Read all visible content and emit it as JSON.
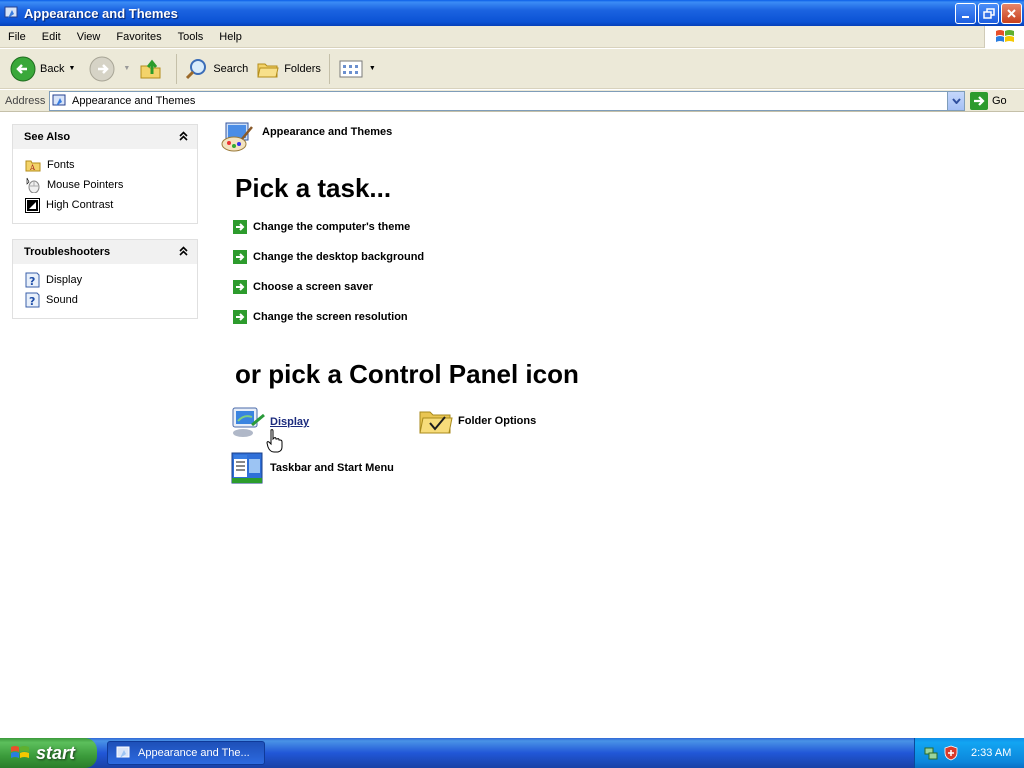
{
  "window": {
    "title": "Appearance and Themes"
  },
  "menu": {
    "items": [
      "File",
      "Edit",
      "View",
      "Favorites",
      "Tools",
      "Help"
    ]
  },
  "toolbar": {
    "back": "Back",
    "search": "Search",
    "folders": "Folders"
  },
  "address": {
    "label": "Address",
    "value": "Appearance and Themes",
    "go": "Go"
  },
  "see_also": {
    "title": "See Also",
    "items": [
      {
        "label": "Fonts",
        "icon": "fonts-folder-icon"
      },
      {
        "label": "Mouse Pointers",
        "icon": "mouse-icon"
      },
      {
        "label": "High Contrast",
        "icon": "high-contrast-icon"
      }
    ]
  },
  "troubleshooters": {
    "title": "Troubleshooters",
    "items": [
      {
        "label": "Display",
        "icon": "help-icon"
      },
      {
        "label": "Sound",
        "icon": "help-icon"
      }
    ]
  },
  "main": {
    "category": "Appearance and Themes",
    "pick_task": "Pick a task...",
    "tasks": [
      "Change the computer's theme",
      "Change the desktop background",
      "Choose a screen saver",
      "Change the screen resolution"
    ],
    "or_pick": "or pick a Control Panel icon",
    "icons": [
      {
        "label": "Display",
        "icon": "display-icon"
      },
      {
        "label": "Folder Options",
        "icon": "folder-options-icon"
      },
      {
        "label": "Taskbar and Start Menu",
        "icon": "taskbar-icon"
      }
    ]
  },
  "taskbar": {
    "start": "start",
    "window_button": "Appearance and The...",
    "clock": "2:33 AM"
  },
  "colors": {
    "title_blue": "#0b52d4",
    "task_green": "#2d9b2d",
    "link_blue": "#1b2a7d"
  }
}
